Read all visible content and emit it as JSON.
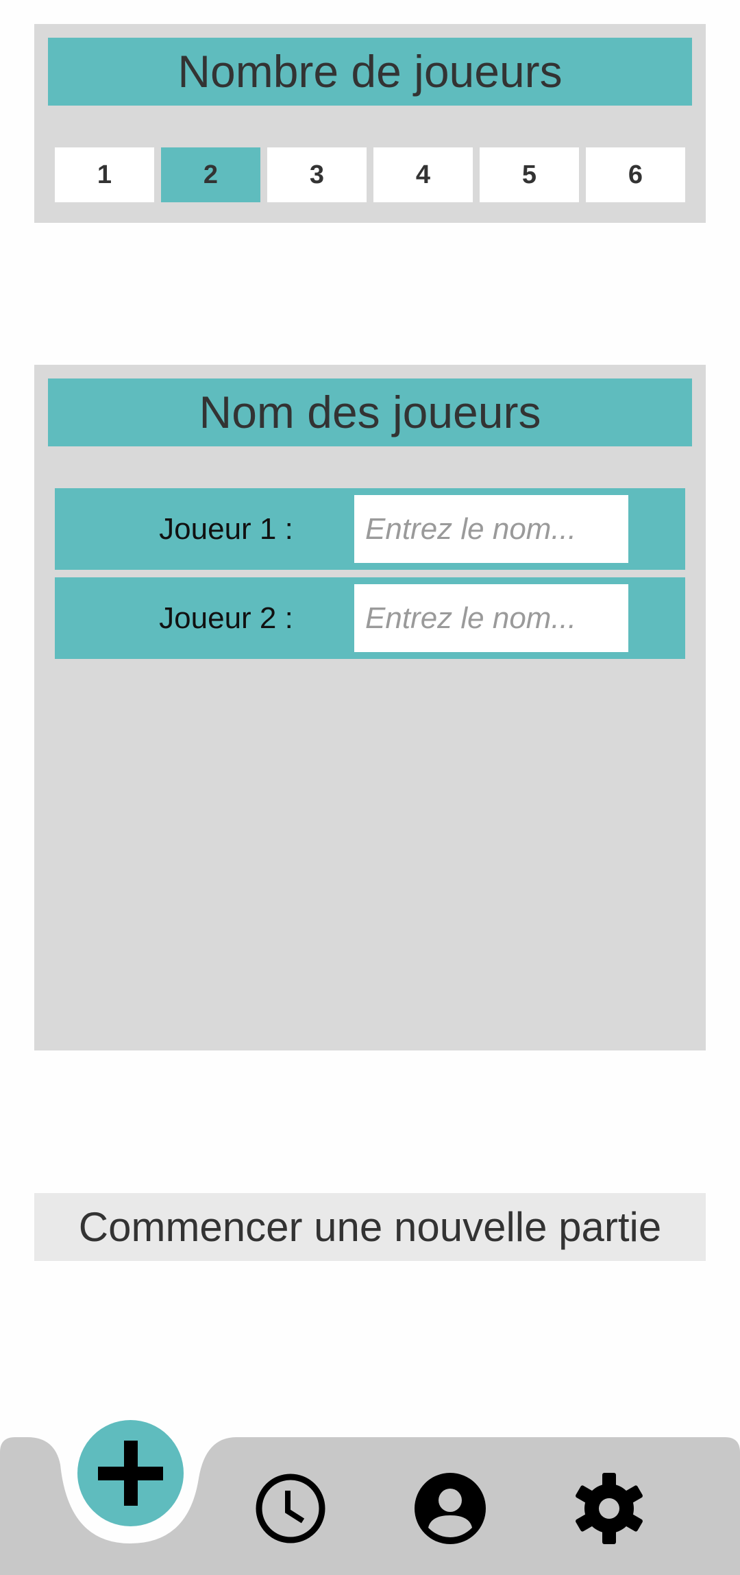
{
  "player_count_section": {
    "title": "Nombre de joueurs",
    "options": [
      "1",
      "2",
      "3",
      "4",
      "5",
      "6"
    ],
    "selected": "2"
  },
  "player_names_section": {
    "title": "Nom des joueurs",
    "players": [
      {
        "label": "Joueur 1 :",
        "value": "",
        "placeholder": "Entrez le nom..."
      },
      {
        "label": "Joueur 2 :",
        "value": "",
        "placeholder": "Entrez le nom..."
      }
    ]
  },
  "start_button": {
    "label": "Commencer une nouvelle partie"
  },
  "nav": {
    "items": [
      {
        "icon": "plus-icon",
        "active": true
      },
      {
        "icon": "clock-icon",
        "active": false
      },
      {
        "icon": "account-icon",
        "active": false
      },
      {
        "icon": "gear-icon",
        "active": false
      }
    ]
  },
  "colors": {
    "accent": "#5fbcbe",
    "panel_bg": "#d9d9d9",
    "nav_bg": "#c8c8c8",
    "button_bg": "#e9e9e9"
  }
}
